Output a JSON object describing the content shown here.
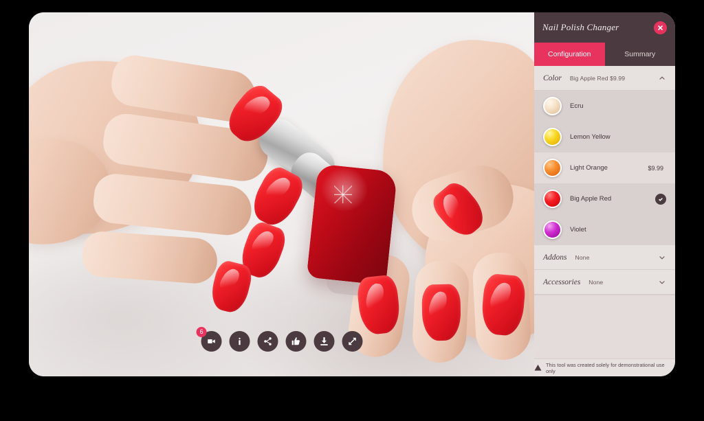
{
  "app": {
    "title": "Nail Polish Changer",
    "close_icon": "close-icon",
    "accent_pink": "#e8335f",
    "dark_plum": "#4b3b40",
    "panel_bg": "#e3dcdb"
  },
  "tabs": [
    {
      "label": "Configuration",
      "active": true
    },
    {
      "label": "Summary",
      "active": false
    }
  ],
  "sections": {
    "color": {
      "name": "Color",
      "value": "Big Apple Red   $9.99",
      "expanded": true,
      "chevron_icon": "chevron-up-icon",
      "options": [
        {
          "label": "Ecru",
          "price": "",
          "swatch": "#f4dcc0",
          "selected": false,
          "stripe": "dark"
        },
        {
          "label": "Lemon Yellow",
          "price": "",
          "swatch": "#f5cf1b",
          "selected": false,
          "stripe": "dark"
        },
        {
          "label": "Light Orange",
          "price": "$9.99",
          "swatch": "#f08127",
          "selected": false,
          "stripe": "light"
        },
        {
          "label": "Big Apple Red",
          "price": "",
          "swatch": "#f2121e",
          "selected": true,
          "stripe": "dark"
        },
        {
          "label": "Violet",
          "price": "",
          "swatch": "#c323c3",
          "selected": false,
          "stripe": "dark"
        }
      ]
    },
    "addons": {
      "name": "Addons",
      "value": "None",
      "expanded": false,
      "chevron_icon": "chevron-down-icon"
    },
    "accessories": {
      "name": "Accessories",
      "value": "None",
      "expanded": false,
      "chevron_icon": "chevron-down-icon"
    }
  },
  "footer": {
    "warning_icon": "warning-triangle-icon",
    "text": "This tool was created solely for demonstrational use only"
  },
  "toolbar": [
    {
      "icon": "video-camera-icon",
      "badge": "6"
    },
    {
      "icon": "info-icon",
      "badge": ""
    },
    {
      "icon": "share-icon",
      "badge": ""
    },
    {
      "icon": "thumbs-up-icon",
      "badge": ""
    },
    {
      "icon": "download-icon",
      "badge": ""
    },
    {
      "icon": "expand-icon",
      "badge": ""
    }
  ],
  "viewer": {
    "alt": "Hands with red painted nails holding a red nail polish bottle"
  }
}
